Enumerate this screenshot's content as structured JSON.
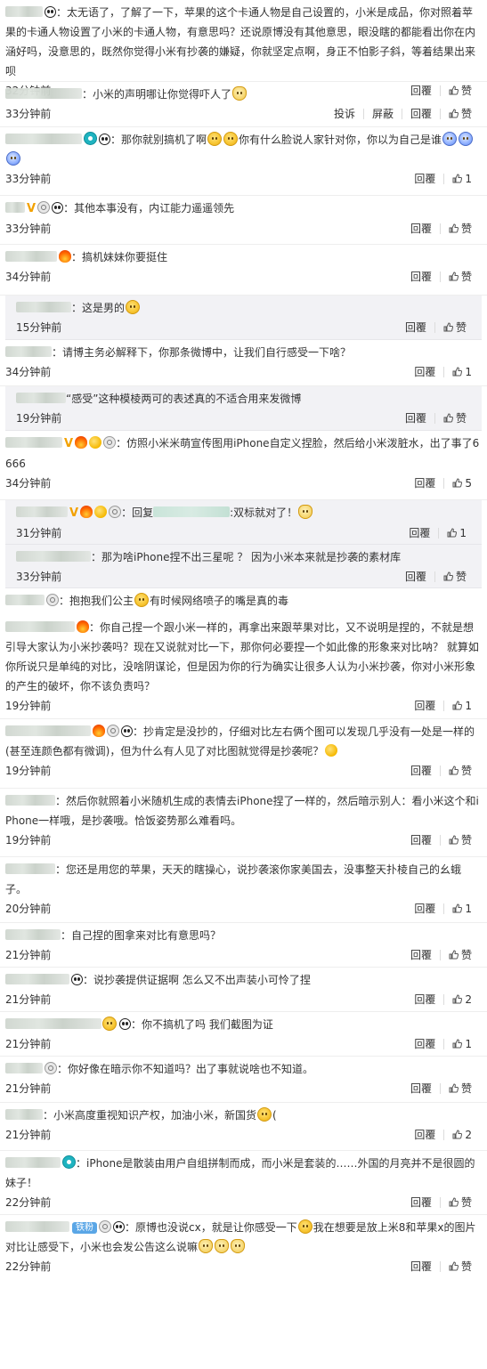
{
  "labels": {
    "reply": "回覆",
    "report": "投诉",
    "block": "屏蔽"
  },
  "comments": [
    {
      "text": "：太无语了，了解了一下，苹果的这个卡通人物是自己设置的，小米是成品，你对照着苹果的卡通人物设置了小米的卡通人物，有意思吗？还说原博没有其他意思，眼没瞎的都能看出你在内涵好吗，没意思的，既然你觉得小米有抄袭的嫌疑，你就坚定点啊，身正不怕影子斜，等着结果出来呗",
      "time": "32分钟前",
      "likes": "赞"
    },
    {
      "text": "小米的声明哪让你觉得吓人了",
      "time": "33分钟前",
      "likes": "赞"
    },
    {
      "text": "：那你就别搞机了啊",
      "text2": "你有什么脸说人家针对你，你以为自己是谁",
      "time": "33分钟前",
      "likes": "1"
    },
    {
      "text": "：其他本事没有，内讧能力遥遥领先",
      "time": "33分钟前",
      "likes": "赞"
    },
    {
      "text": "：搞机妹妹你要挺住",
      "time": "34分钟前",
      "likes": "赞"
    },
    {
      "text": "：这是男的",
      "time": "15分钟前",
      "likes": "赞"
    },
    {
      "text": "：请博主务必解释下，你那条微博中，让我们自行感受一下啥？",
      "time": "34分钟前",
      "likes": "1"
    },
    {
      "text": "“感受”这种模棱两可的表述真的不适合用来发微博",
      "time": "19分钟前",
      "likes": "赞"
    },
    {
      "text": "：仿照小米米萌宣传图用iPhone自定义捏脸，然后给小米泼脏水，出了事了6666",
      "time": "34分钟前",
      "likes": "5"
    },
    {
      "text": "：回复",
      "text2": ":双标就对了！",
      "time": "31分钟前",
      "likes": "1"
    },
    {
      "text": "：那为啥iPhone捏不出三星呢 ？ 因为小米本来就是抄袭的素材库",
      "time": "33分钟前",
      "likes": "赞"
    },
    {
      "text": "：抱抱我们公主",
      "text2": "有时候网络喷子的嘴是真的毒",
      "time": "",
      "likes": ""
    },
    {
      "text": "：你自己捏一个跟小米一样的，再拿出来跟苹果对比，又不说明是捏的，不就是想引导大家认为小米抄袭吗？现在又说就对比一下，那你何必要捏一个如此像的形象来对比呐？ 就算如你所说只是单纯的对比，没啥阴谋论，但是因为你的行为确实让很多人认为小米抄袭，你对小米形象的产生的破坏，你不该负责吗？",
      "time": "19分钟前",
      "likes": "1"
    },
    {
      "text": "：抄肯定是没抄的，仔细对比左右俩个图可以发现几乎没有一处是一样的(甚至连颜色都有微调)，但为什么有人见了对比图就觉得是抄袭呢？",
      "time": "19分钟前",
      "likes": "赞"
    },
    {
      "text": "然后你就照着小米随机生成的表情去iPhone捏了一样的，然后暗示别人：看小米这个和iPhone一样哦，是抄袭哦。恰饭姿势那么难看吗。",
      "time": "19分钟前",
      "likes": "赞"
    },
    {
      "text": "：您还是用您的苹果，天天的瞎操心，说抄袭滚你家美国去，没事整天扑棱自己的幺蛾子。",
      "time": "20分钟前",
      "likes": "1"
    },
    {
      "text": "自己捏的图拿来对比有意思吗？",
      "time": "21分钟前",
      "likes": "赞"
    },
    {
      "text": "：说抄袭提供证据啊 怎么又不出声装小可怜了捏",
      "time": "21分钟前",
      "likes": "2"
    },
    {
      "text": "：你不搞机了吗 我们截图为证",
      "time": "21分钟前",
      "likes": "1"
    },
    {
      "text": "：你好像在暗示你不知道吗？出了事就说啥也不知道。",
      "time": "21分钟前",
      "likes": "赞"
    },
    {
      "text": "小米高度重视知识产权，加油小米，新国货",
      "text2": "(",
      "time": "21分钟前",
      "likes": "2"
    },
    {
      "text": "：iPhone是散装由用户自组拼制而成，而小米是套装的……外国的月亮并不是很圆的妹子！",
      "time": "22分钟前",
      "likes": "赞"
    },
    {
      "text": "：原博也没说cx，就是让你感受一下",
      "text2": "我在想要是放上米8和苹果x的图片对比让感受下，小米也会发公告这么说嘛",
      "badge": "铁粉",
      "time": "22分钟前",
      "likes": "赞"
    }
  ]
}
